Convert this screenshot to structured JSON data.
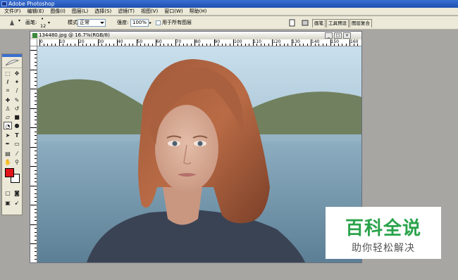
{
  "app": {
    "title": "Adobe Photoshop"
  },
  "menu": [
    "文件(F)",
    "编辑(E)",
    "图像(I)",
    "图层(L)",
    "选择(S)",
    "滤镜(T)",
    "视图(V)",
    "窗口(W)",
    "帮助(H)"
  ],
  "options": {
    "brush_label": "画笔:",
    "brush_size": "12",
    "mode_label": "模式:",
    "mode_value": "正常",
    "strength_label": "强度:",
    "strength_value": "100%",
    "all_layers_label": "用于所有图层"
  },
  "palette_tabs": [
    "画笔",
    "工具预设",
    "图层复合"
  ],
  "document": {
    "title": "134480.jpg @ 16.7%(RGB/8)",
    "ruler_labels": [
      "0",
      "10",
      "20",
      "30",
      "40",
      "50",
      "60",
      "70",
      "80",
      "90",
      "100",
      "110",
      "120",
      "130",
      "140",
      "150",
      "160"
    ]
  },
  "watermark": {
    "title": "百科全说",
    "subtitle": "助你轻松解决"
  },
  "colors": {
    "foreground": "#e0151b",
    "background": "#ffffff",
    "accent_blue": "#3a6fd0",
    "watermark_green": "#2aa34a"
  },
  "icons": {
    "tool": "smudge-tool-icon"
  }
}
